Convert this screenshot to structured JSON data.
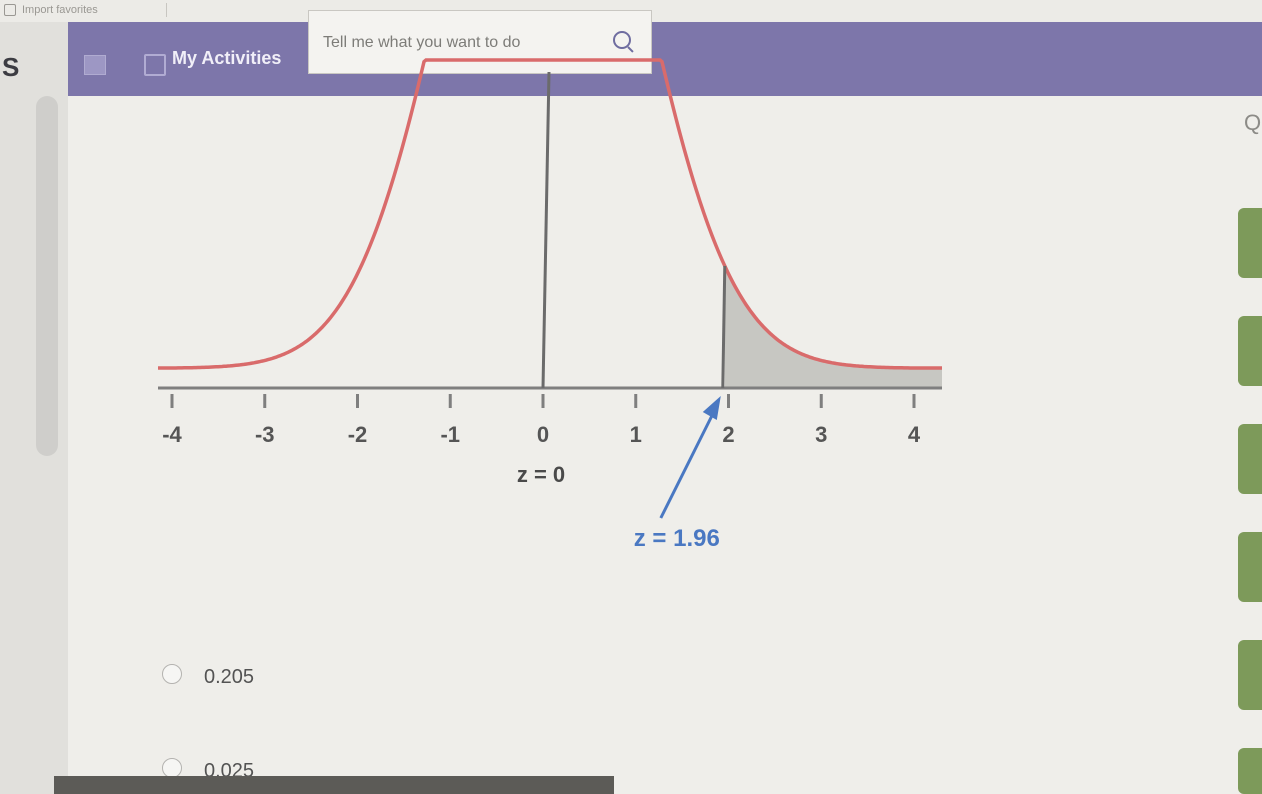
{
  "browser_bar": {
    "favorites_text": "Import favorites"
  },
  "left_letter": "S",
  "header": {
    "my_activities_label": "My Activities",
    "search_placeholder": "Tell me what you want to do",
    "accent": "#7d76aa"
  },
  "chart_data": {
    "type": "area",
    "title": "",
    "xlabel": "",
    "ylabel": "",
    "xlim": [
      -4,
      4
    ],
    "x_ticks": [
      "-4",
      "-3",
      "-2",
      "-1",
      "0",
      "1",
      "2",
      "3",
      "4"
    ],
    "curve_color": "#d96b6b",
    "shaded_region": {
      "from": 1.96,
      "to": 4,
      "fill": "#c7c7c2"
    },
    "annotations": [
      {
        "text": "z = 0",
        "x": 0,
        "color": "#4a4a4a"
      },
      {
        "text": "z = 1.96",
        "x": 1.96,
        "color": "#4a78c2"
      }
    ]
  },
  "options": [
    {
      "label": "0.205"
    },
    {
      "label": "0.025"
    }
  ],
  "right_glyph": "Q"
}
